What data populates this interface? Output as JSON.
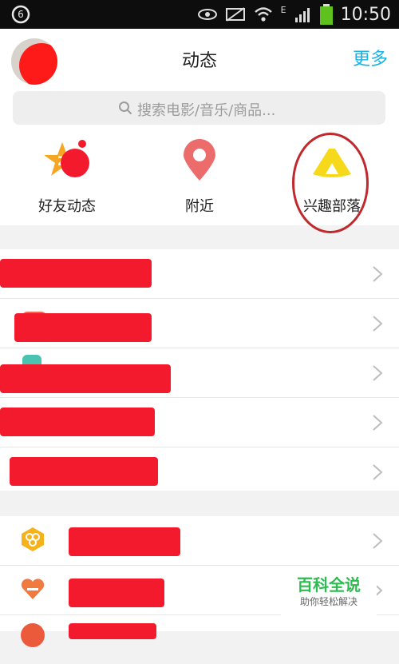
{
  "status_bar": {
    "time": "10:50",
    "network_letter": "E"
  },
  "header": {
    "title": "动态",
    "more_label": "更多"
  },
  "search": {
    "placeholder": "搜索电影/音乐/商品..."
  },
  "quick_actions": [
    {
      "label": "好友动态",
      "icon": "star-z-icon"
    },
    {
      "label": "附近",
      "icon": "location-pin-icon"
    },
    {
      "label": "兴趣部落",
      "icon": "tent-icon"
    }
  ],
  "colors": {
    "accent": "#19b3e5",
    "redaction": "#f21a2c",
    "status_bg": "#0d0d0d"
  },
  "watermark": {
    "title": "百科全说",
    "subtitle": "助你轻松解决"
  }
}
